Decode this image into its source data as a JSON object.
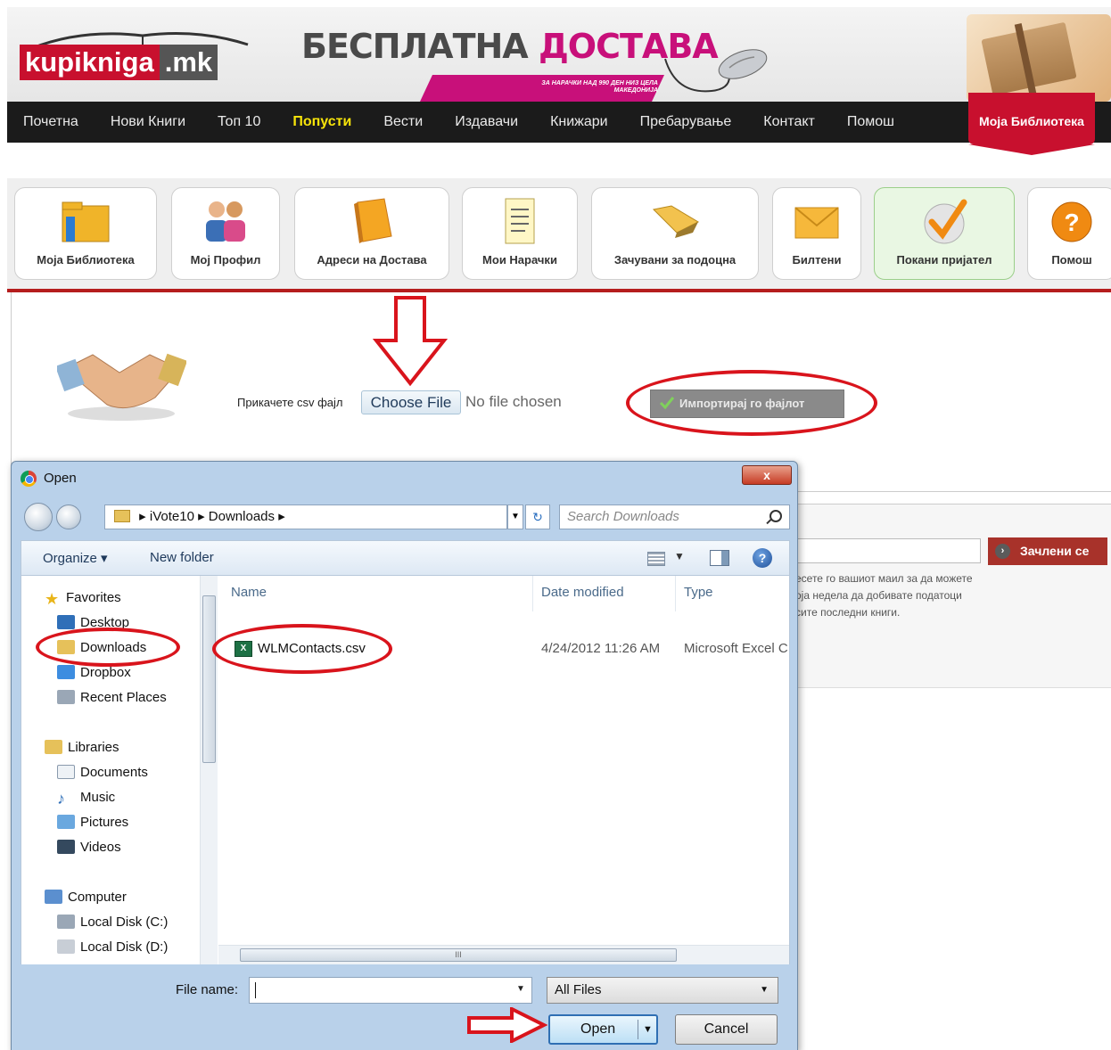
{
  "site": {
    "logo_left": "kupikniga",
    "logo_right": ".mk",
    "promo_word1": "БЕСПЛАТНА",
    "promo_word2": "ДОСТАВА",
    "promo_small": "ЗА НАРАЧКИ НАД 990 ДЕН НИЗ ЦЕЛА МАКЕДОНИЈА"
  },
  "nav": {
    "items": [
      "Почетна",
      "Нови Книги",
      "Топ 10",
      "Попусти",
      "Вести",
      "Издавачи",
      "Книжари",
      "Пребарување",
      "Контакт",
      "Помош"
    ],
    "highlight": "Попусти",
    "library": "Моја Библиотека"
  },
  "tiles": [
    {
      "label": "Моја Библиотека",
      "icon": "library-folder-icon"
    },
    {
      "label": "Мој Профил",
      "icon": "profile-people-icon"
    },
    {
      "label": "Адреси на Достава",
      "icon": "address-book-icon"
    },
    {
      "label": "Мои Нарачки",
      "icon": "orders-document-icon"
    },
    {
      "label": "Зачувани за подоцна",
      "icon": "saved-folder-icon"
    },
    {
      "label": "Билтени",
      "icon": "envelope-icon"
    },
    {
      "label": "Покани пријател",
      "icon": "checkmark-icon"
    },
    {
      "label": "Помош",
      "icon": "help-icon"
    }
  ],
  "invite": {
    "attach_label": "Прикачете csv фајл",
    "choose_label": "Choose File",
    "no_file": "No file chosen",
    "import_label": "Импортирај го фајлот"
  },
  "newsletter": {
    "button": "Зачлени се",
    "lines": [
      "есете го вашиот маил за да можете",
      "оја недела да добивате податоци",
      "сите последни книги."
    ]
  },
  "dialog": {
    "title": "Open",
    "close": "x",
    "path": [
      "iVote10",
      "Downloads"
    ],
    "search_placeholder": "Search Downloads",
    "organize": "Organize ▾",
    "new_folder": "New folder",
    "nav": {
      "favorites": "Favorites",
      "desktop": "Desktop",
      "downloads": "Downloads",
      "dropbox": "Dropbox",
      "recent": "Recent Places",
      "libraries": "Libraries",
      "documents": "Documents",
      "music": "Music",
      "pictures": "Pictures",
      "videos": "Videos",
      "computer": "Computer",
      "disk_c": "Local Disk (C:)",
      "disk_d": "Local Disk (D:)"
    },
    "columns": {
      "name": "Name",
      "date": "Date modified",
      "type": "Type"
    },
    "file": {
      "name": "WLMContacts.csv",
      "date": "4/24/2012 11:26 AM",
      "type": "Microsoft Excel C"
    },
    "file_name_label": "File name:",
    "file_name_value": "",
    "filter": "All Files",
    "open_label": "Open",
    "cancel_label": "Cancel",
    "scroll_grip": "III"
  },
  "colors": {
    "brand_red": "#c8102e",
    "annotation_red": "#d9141c",
    "nav_bg": "#1b1b1b",
    "highlight": "#f7e40a"
  }
}
